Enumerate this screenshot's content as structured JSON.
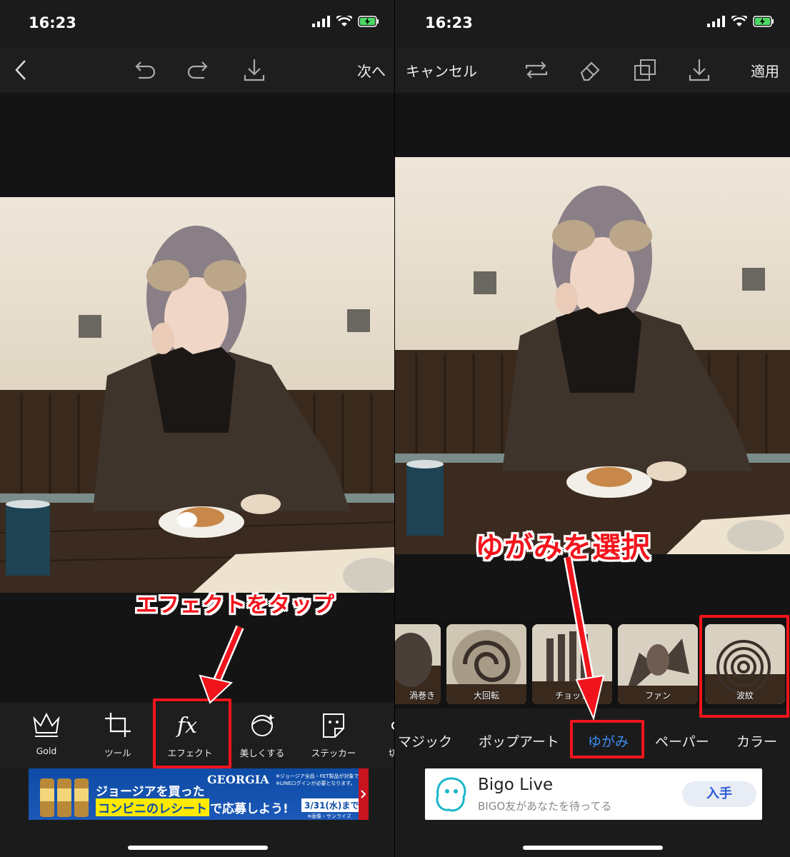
{
  "left": {
    "status": {
      "time": "16:23"
    },
    "toolbar": {
      "back": "back",
      "undo": "undo",
      "redo": "redo",
      "download": "download",
      "next": "次へ"
    },
    "tools": [
      {
        "label": "Gold",
        "icon": "crown-icon"
      },
      {
        "label": "ツール",
        "icon": "crop-icon"
      },
      {
        "label": "エフェクト",
        "icon": "fx-icon"
      },
      {
        "label": "美しくする",
        "icon": "face-beautify-icon"
      },
      {
        "label": "ステッカー",
        "icon": "sticker-icon"
      },
      {
        "label": "切",
        "icon": "cutout-icon"
      }
    ],
    "annotation": "エフェクトをタップ",
    "ad": {
      "brand": "GEORGIA",
      "line1": "ジョージアを買った",
      "highlight": "コンビニのレシート",
      "line2": "で応募しよう!",
      "date": "3/31(水)まで",
      "fine1": "※ジョージア全品・FET製品が対象です。",
      "fine2": "※LINEログインが必要となります。",
      "fine3": "※画像・サンライズ"
    }
  },
  "right": {
    "status": {
      "time": "16:23"
    },
    "toolbar": {
      "cancel": "キャンセル",
      "apply": "適用"
    },
    "annotation": "ゆがみを選択",
    "thumbnails": [
      {
        "label": "渦巻き"
      },
      {
        "label": "大回転"
      },
      {
        "label": "チョップ"
      },
      {
        "label": "ファン"
      },
      {
        "label": "波紋"
      }
    ],
    "tabs": [
      {
        "label": "マジック"
      },
      {
        "label": "ポップアート"
      },
      {
        "label": "ゆがみ"
      },
      {
        "label": "ペーパー"
      },
      {
        "label": "カラー"
      }
    ],
    "ad": {
      "title": "Bigo Live",
      "subtitle": "BIGO友があなたを待ってる",
      "cta": "入手"
    }
  },
  "colors": {
    "annotation": "#f2141c",
    "active_tab": "#3d8ff5",
    "bg": "#1b1b1b"
  }
}
